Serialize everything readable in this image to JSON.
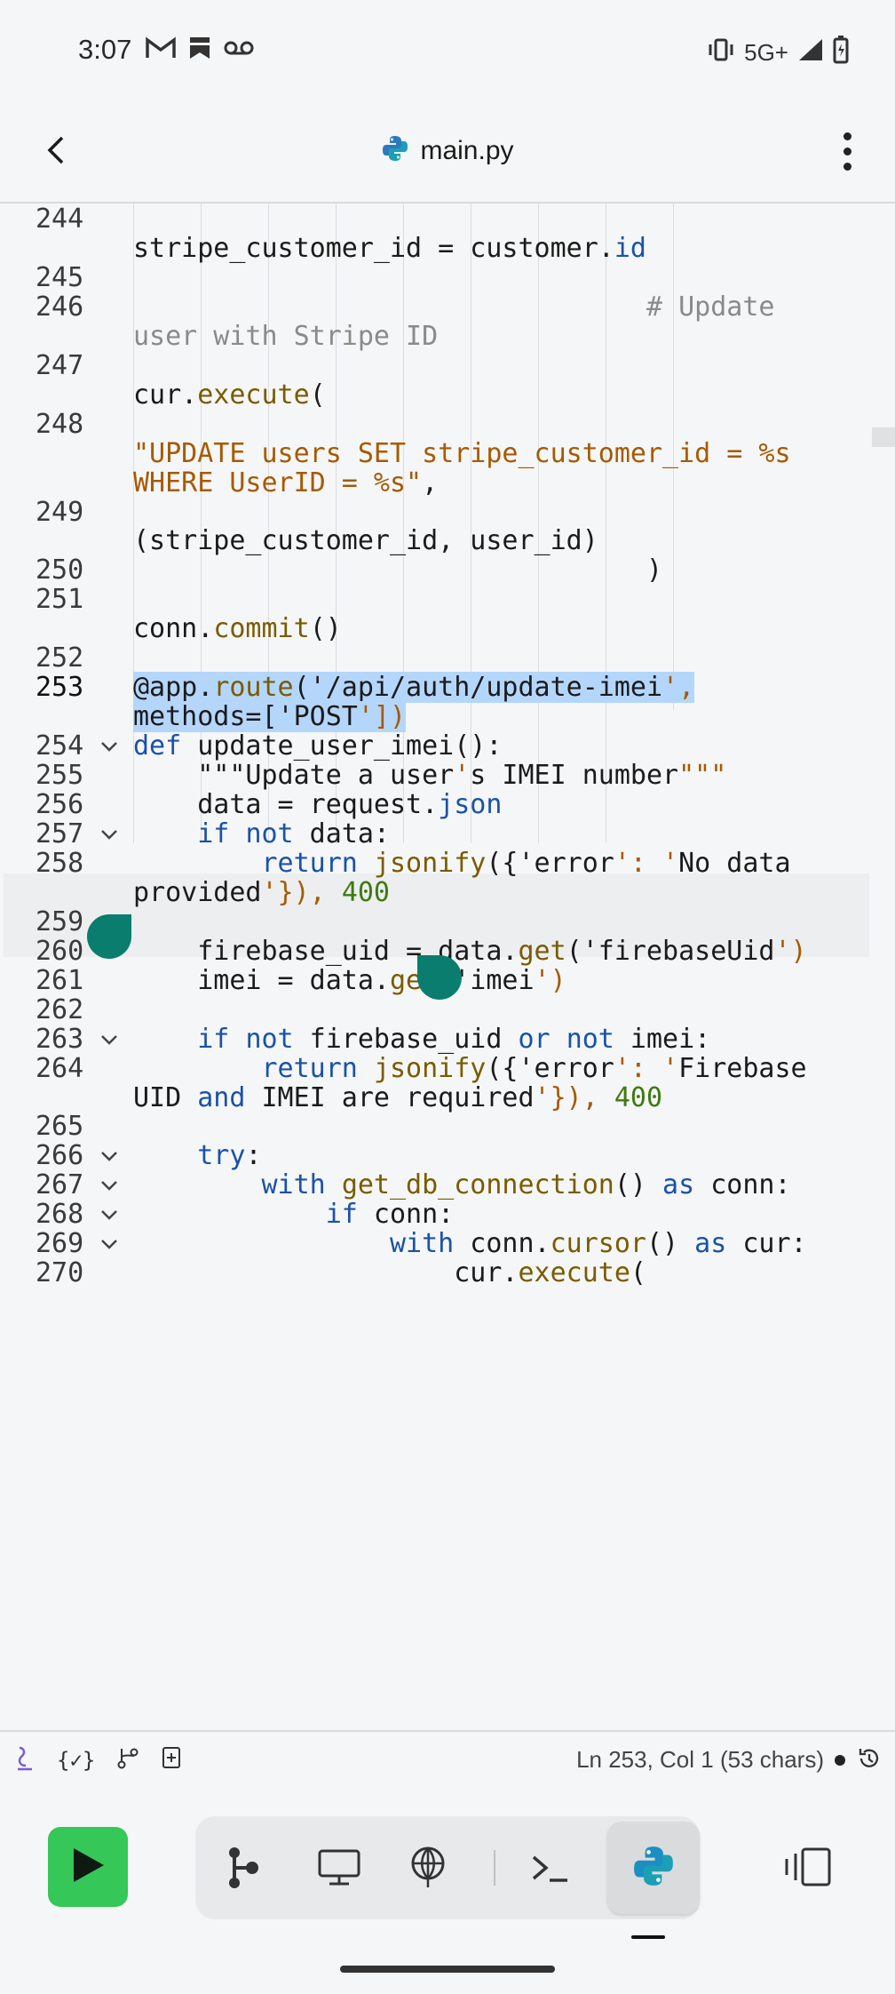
{
  "status_bar": {
    "time": "3:07",
    "left_icons": [
      "gmail-icon",
      "bookmark-icon",
      "voicemail-icon"
    ],
    "network": "5G+",
    "right_icons": [
      "vibrate-icon",
      "signal-icon",
      "battery-charging-icon"
    ]
  },
  "app_bar": {
    "title": "main.py",
    "back_icon": "back-arrow-icon",
    "file_icon": "python-icon",
    "menu_icon": "more-vert-icon"
  },
  "editor": {
    "lines": [
      {
        "n": "244",
        "text": ""
      },
      {
        "n": "",
        "text": "stripe_customer_id = customer.id"
      },
      {
        "n": "245",
        "text": ""
      },
      {
        "n": "246",
        "text": "                                # Update"
      },
      {
        "n": "",
        "text": "user with Stripe ID"
      },
      {
        "n": "247",
        "text": ""
      },
      {
        "n": "",
        "text": "cur.execute("
      },
      {
        "n": "248",
        "text": ""
      },
      {
        "n": "",
        "text": "\"UPDATE users SET stripe_customer_id = %s"
      },
      {
        "n": "",
        "text": "WHERE UserID = %s\","
      },
      {
        "n": "249",
        "text": ""
      },
      {
        "n": "",
        "text": "(stripe_customer_id, user_id)"
      },
      {
        "n": "250",
        "text": "                                )"
      },
      {
        "n": "251",
        "text": ""
      },
      {
        "n": "",
        "text": "conn.commit()"
      },
      {
        "n": "252",
        "text": ""
      },
      {
        "n": "253",
        "text": "@app.route('/api/auth/update-imei',"
      },
      {
        "n": "",
        "text": "methods=['POST'])"
      },
      {
        "n": "254",
        "text": "def update_user_imei():"
      },
      {
        "n": "255",
        "text": "    \"\"\"Update a user's IMEI number\"\"\""
      },
      {
        "n": "256",
        "text": "    data = request.json"
      },
      {
        "n": "257",
        "text": "    if not data:"
      },
      {
        "n": "258",
        "text": "        return jsonify({'error': 'No data"
      },
      {
        "n": "",
        "text": "provided'}), 400"
      },
      {
        "n": "259",
        "text": ""
      },
      {
        "n": "260",
        "text": "    firebase_uid = data.get('firebaseUid')"
      },
      {
        "n": "261",
        "text": "    imei = data.get('imei')"
      },
      {
        "n": "262",
        "text": ""
      },
      {
        "n": "263",
        "text": "    if not firebase_uid or not imei:"
      },
      {
        "n": "264",
        "text": "        return jsonify({'error': 'Firebase"
      },
      {
        "n": "",
        "text": "UID and IMEI are required'}), 400"
      },
      {
        "n": "265",
        "text": ""
      },
      {
        "n": "266",
        "text": "    try:"
      },
      {
        "n": "267",
        "text": "        with get_db_connection() as conn:"
      },
      {
        "n": "268",
        "text": "            if conn:"
      },
      {
        "n": "269",
        "text": "                with conn.cursor() as cur:"
      },
      {
        "n": "270",
        "text": "                    cur.execute("
      }
    ],
    "current_line": "253"
  },
  "info_bar": {
    "cursor_position": "Ln 253, Col 1 (53 chars)",
    "icons": [
      "ai-assist-icon",
      "variables-icon",
      "git-branch-icon",
      "add-file-icon",
      "unsaved-dot-icon",
      "history-icon"
    ]
  },
  "toolbar": {
    "run_icon": "play-icon",
    "tools": [
      "graph-icon",
      "monitor-icon",
      "network-icon",
      "terminal-icon",
      "python-icon"
    ],
    "active_tool": "python-icon",
    "panel_icon": "split-panel-icon"
  },
  "colors": {
    "run_green": "#35c758",
    "selection": "#b4d6fb",
    "handle_teal": "#0b7d6e",
    "keyword_blue": "#1a52a8",
    "string_orange": "#a65a00",
    "number_green": "#3f7a11"
  }
}
